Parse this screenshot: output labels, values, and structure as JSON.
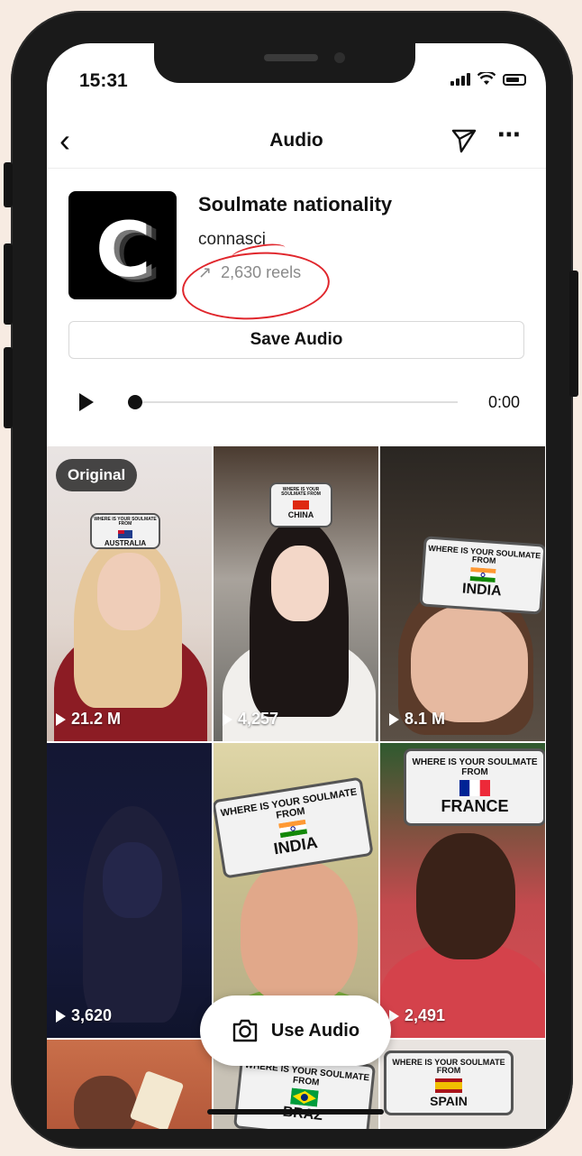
{
  "status": {
    "time": "15:31"
  },
  "header": {
    "title": "Audio"
  },
  "audio": {
    "title": "Soulmate nationality",
    "artist": "connasci",
    "reels": "2,630 reels",
    "save_label": "Save Audio",
    "time": "0:00",
    "progress": 0
  },
  "colors": {
    "annotation": "#e0262c",
    "text": "#111111",
    "muted": "#8a8a8a"
  },
  "reels": [
    {
      "badge": "Original",
      "sign_question": "WHERE IS YOUR SOULMATE FROM",
      "sign_country": "AUSTRALIA",
      "views": "21.2 M"
    },
    {
      "sign_question": "WHERE IS YOUR SOULMATE FROM",
      "sign_country": "CHINA",
      "views": "4,257"
    },
    {
      "sign_question": "WHERE IS YOUR SOULMATE FROM",
      "sign_country": "INDIA",
      "views": "8.1 M"
    },
    {
      "views": "3,620"
    },
    {
      "sign_question": "WHERE IS YOUR SOULMATE FROM",
      "sign_country": "INDIA"
    },
    {
      "sign_question": "WHERE IS YOUR SOULMATE FROM",
      "sign_country": "FRANCE",
      "views": "2,491"
    },
    {},
    {
      "sign_question": "WHERE IS YOUR SOULMATE FROM",
      "sign_country": "BRAZ"
    },
    {
      "sign_question": "WHERE IS YOUR SOULMATE FROM",
      "sign_country": "SPAIN"
    }
  ],
  "use_audio": {
    "label": "Use Audio"
  },
  "icons": [
    "back-arrow-icon",
    "send-icon",
    "more-icon",
    "trend-arrow-icon",
    "play-icon",
    "camera-icon"
  ]
}
